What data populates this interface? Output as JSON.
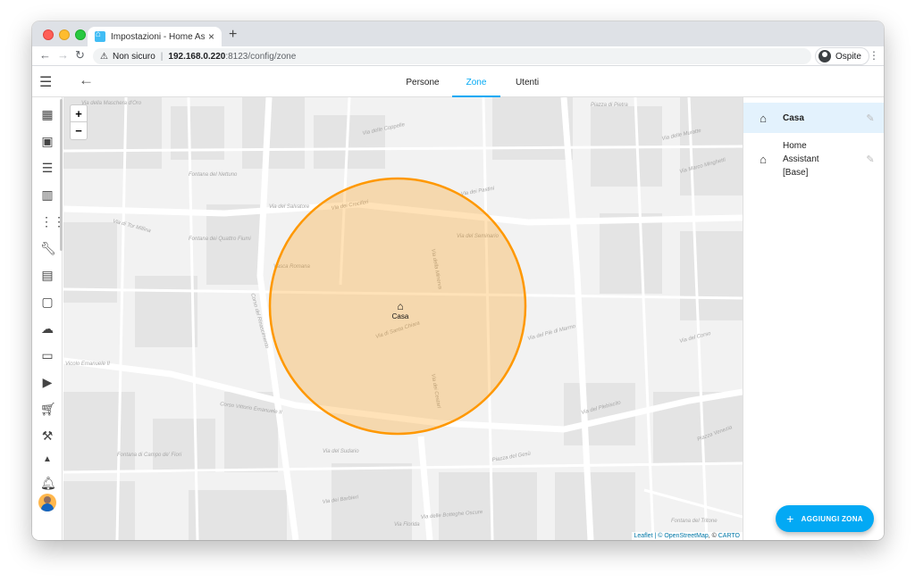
{
  "browser": {
    "tab_title": "Impostazioni - Home Assistant",
    "tab_close": "×",
    "new_tab": "+",
    "security_label": "Non sicuro",
    "url_host": "192.168.0.220",
    "url_path": ":8123/config/zone",
    "profile_name": "Ospite"
  },
  "header": {
    "tabs": [
      {
        "label": "Persone"
      },
      {
        "label": "Zone",
        "active": true
      },
      {
        "label": "Utenti"
      }
    ]
  },
  "map": {
    "zoom_in": "+",
    "zoom_out": "−",
    "zone_label": "Casa",
    "attribution_prefix": "Leaflet | © ",
    "attribution_osm": "OpenStreetMap",
    "attribution_mid": ", © ",
    "attribution_carto": "CARTO",
    "street_labels": [
      "Via della Maschera d'Oro",
      "Via delle Coppelle",
      "Via dei Crociferi",
      "Via del Salvatore",
      "Via del Seminario",
      "Via della Minerva",
      "Via di Tor Millina",
      "Via di Santa Chiara",
      "Via del Piè di Marmo",
      "Corso del Rinascimento",
      "Corso Vittorio Emanuele II",
      "Vicolo Emanuele II",
      "Via del Sudario",
      "Piazza del Gesù",
      "Via delle Botteghe Oscure",
      "Via dei Cestari",
      "Via del Plebiscito",
      "Via del Corso",
      "Piazza Venezia",
      "Fontana del Nettuno",
      "Fontana dei Quattro Fiumi",
      "Fontana di Campo de' Fiori",
      "Vasca Romana",
      "Piazza di Pietra",
      "Via dei Pastini",
      "Via Marco Minghetti",
      "Via dei Barbieri",
      "Via Florida",
      "Fontana del Tritone",
      "Via delle Muratte"
    ]
  },
  "zones": [
    {
      "name": "Casa",
      "selected": true
    },
    {
      "name": "Home Assistant [Base]",
      "selected": false
    }
  ],
  "actions": {
    "add_zone": "AGGIUNGI ZONA"
  },
  "colors": {
    "accent": "#03a9f4",
    "zone_fill": "#ff9800",
    "zone_stroke": "#ff9800"
  }
}
